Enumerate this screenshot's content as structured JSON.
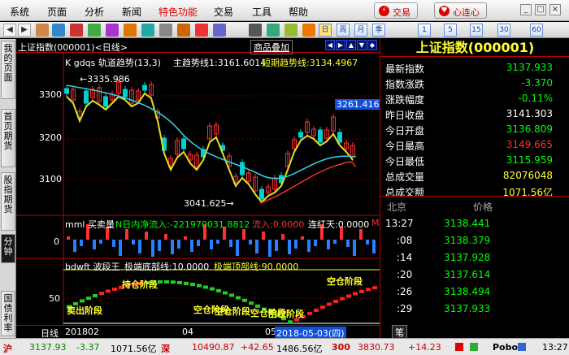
{
  "menu": {
    "items": [
      "系统",
      "页面",
      "分析",
      "新闻",
      "特色功能",
      "交易",
      "工具",
      "帮助"
    ],
    "trade_label": "交易",
    "xlx_label": "心连心"
  },
  "toolbar": {
    "period_buttons": [
      "日",
      "周",
      "月",
      "季",
      "1",
      "5",
      "15",
      "30",
      "60"
    ]
  },
  "sidebar": {
    "tabs": [
      "我的页面",
      "首页期货",
      "股指期货",
      "分钟",
      "国债利率"
    ]
  },
  "chart": {
    "header": "上证指数(000001)<日线>",
    "overlay_btn": "商品叠加",
    "main_legend": {
      "name": "K  gdqs 轨道趋势(13,3)",
      "main_trend": "主趋势线1:3161.6014",
      "short_trend": "短期趋势线:3134.4967"
    },
    "y_labels": [
      "3300",
      "3200",
      "3100"
    ],
    "high_annotation": "3335.986",
    "low_annotation": "3041.625",
    "cursor_price": "3261.416",
    "vol_legend": {
      "name": "mml 买卖量",
      "net_inflow": "N日内净流入:-221970031.8812",
      "inflow": "流入:0.0000",
      "red_days": "连红天:0.0000",
      "m": "M"
    },
    "vol_y": "0",
    "wave_legend": {
      "name": "bdwft 波段王",
      "bottom_line": "极端底部线:10.0000",
      "top_line": "极端顶部线:90.0000"
    },
    "wave_y": "50",
    "wave_labels": [
      "卖出阶段",
      "持仓阶段",
      "空仓阶段",
      "空仓阶段",
      "空仓阶段",
      "空仓阶段",
      "空仓阶段"
    ],
    "x_axis": {
      "period": "日线",
      "labels": [
        "201802",
        "04",
        "05"
      ],
      "cursor_date": "2018-05-03(四)"
    }
  },
  "quote": {
    "title": "上证指数(000001)",
    "rows": [
      {
        "label": "最新指数",
        "value": "3137.933",
        "color": "#00ff00"
      },
      {
        "label": "指数涨跌",
        "value": "-3.370",
        "color": "#00ff00"
      },
      {
        "label": "涨跌幅度",
        "value": "-0.11%",
        "color": "#00ff00"
      },
      {
        "label": "昨日收盘",
        "value": "3141.303",
        "color": "#ffffff"
      },
      {
        "label": "今日开盘",
        "value": "3136.809",
        "color": "#00ff00"
      },
      {
        "label": "今日最高",
        "value": "3149.665",
        "color": "#ff3030"
      },
      {
        "label": "今日最低",
        "value": "3115.959",
        "color": "#00ff00"
      },
      {
        "label": "总成交量",
        "value": "82076048",
        "color": "#ffff30"
      },
      {
        "label": "总成交额",
        "value": "1071.56亿",
        "color": "#ffff30"
      }
    ],
    "tick_header": {
      "col1": "北京",
      "col2": "价格"
    },
    "ticks": [
      {
        "time": "13:27",
        "price": "3138.441"
      },
      {
        "time": ":08",
        "price": "3138.379"
      },
      {
        "time": ":14",
        "price": "3137.928"
      },
      {
        "time": ":20",
        "price": "3137.614"
      },
      {
        "time": ":26",
        "price": "3138.494"
      },
      {
        "time": ":29",
        "price": "3137.933"
      }
    ],
    "bottom_tab": "笔"
  },
  "status": {
    "sh_label": "沪",
    "sh_price": "3137.93",
    "sh_change": "-3.37",
    "sh_amount": "1071.56亿",
    "sz_label": "深",
    "sz_price": "10490.87",
    "sz_change": "+42.65",
    "sz_amount": "1486.56亿",
    "other_label": "300",
    "other_price": "3830.73",
    "other_change": "+14.23",
    "pobo": "Pobo",
    "time": "13:27"
  }
}
